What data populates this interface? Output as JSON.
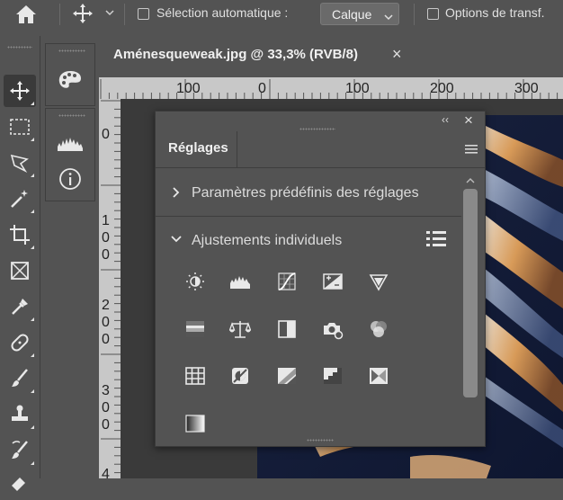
{
  "options_bar": {
    "auto_select_label": "Sélection automatique :",
    "auto_select_value": "Calque",
    "transform_label": "Options de transf."
  },
  "document": {
    "tab_title": "Aménesqueweak.jpg @ 33,3% (RVB/8)",
    "close_glyph": "×"
  },
  "ruler": {
    "h_labels": [
      "100",
      "0",
      "100",
      "200",
      "300"
    ],
    "v_labels": [
      [
        "0"
      ],
      [
        "1",
        "0",
        "0"
      ],
      [
        "2",
        "0",
        "0"
      ],
      [
        "3",
        "0",
        "0"
      ],
      [
        "4"
      ]
    ]
  },
  "panel": {
    "tab_label": "Réglages",
    "collapse_glyph": "‹‹",
    "close_glyph": "×",
    "presets_label": "Paramètres prédéfinis des réglages",
    "individual_label": "Ajustements individuels"
  },
  "adjustment_icons": [
    "brightness-contrast-icon",
    "levels-icon",
    "curves-icon",
    "exposure-icon",
    "vibrance-icon",
    "hue-saturation-icon",
    "color-balance-icon",
    "black-white-icon",
    "photo-filter-icon",
    "channel-mixer-icon",
    "color-lookup-icon",
    "invert-icon",
    "posterize-icon",
    "threshold-icon",
    "selective-color-icon",
    "gradient-map-icon"
  ],
  "colors": {
    "ui_bg": "#535353",
    "ruler_bg": "#c8c8c8",
    "canvas_bg": "#3a3a3a"
  }
}
